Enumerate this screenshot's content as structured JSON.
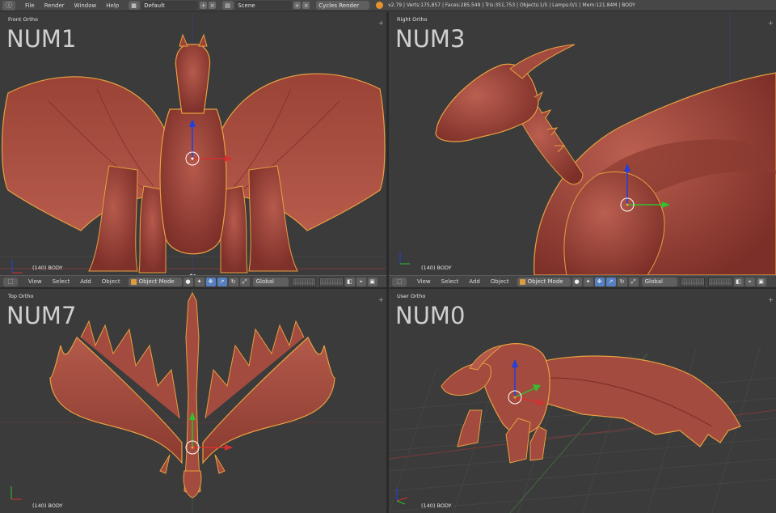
{
  "topbar": {
    "menus": [
      "File",
      "Render",
      "Window",
      "Help"
    ],
    "screen_layout": "Default",
    "scene": "Scene",
    "render_engine": "Cycles Render",
    "stats": "v2.79 | Verts:175,857 | Faces:285,549 | Tris:351,753 | Objects:1/5 | Lamps:0/1 | Mem:121.84M | BODY"
  },
  "viewports": {
    "front": {
      "view_name": "Front Ortho",
      "overlay": "NUM1",
      "object_info": "(140) BODY"
    },
    "right": {
      "view_name": "Right Ortho",
      "overlay": "NUM3",
      "object_info": "(140) BODY"
    },
    "top": {
      "view_name": "Top Ortho",
      "overlay": "NUM7",
      "object_info": "(140) BODY"
    },
    "user": {
      "view_name": "User Ortho",
      "overlay": "NUM0",
      "object_info": "(140) BODY"
    }
  },
  "header": {
    "menus": [
      "View",
      "Select",
      "Add",
      "Object"
    ],
    "mode": "Object Mode",
    "orientation": "Global"
  },
  "colors": {
    "model": "#a0453a",
    "model_shade": "#6e2a24",
    "selection_outline": "#e8a040",
    "axis_x": "#d63030",
    "axis_y": "#30c030",
    "axis_z": "#2040e0",
    "viewport_bg": "#3b3b3b",
    "grid": "#444444"
  }
}
